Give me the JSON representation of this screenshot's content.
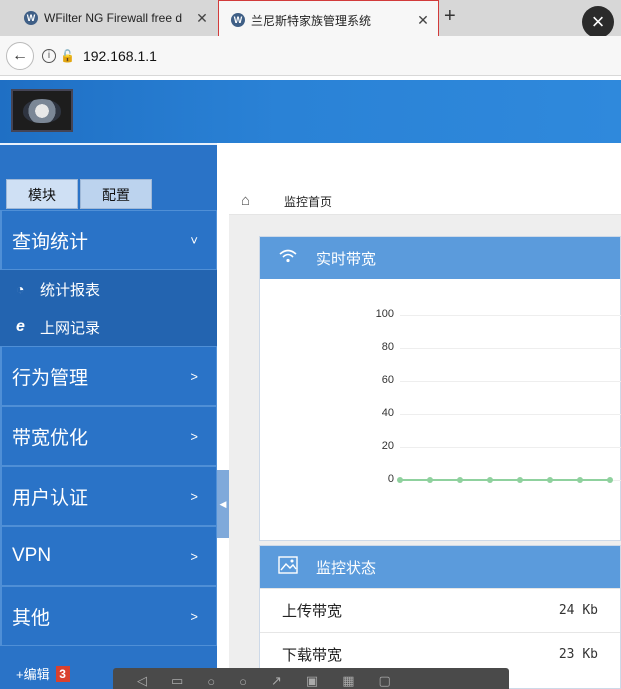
{
  "browser": {
    "tabs": [
      {
        "title": "WFilter NG Firewall free d",
        "active": false
      },
      {
        "title": "兰尼斯特家族管理系统",
        "active": true
      }
    ],
    "new_tab_label": "+",
    "close_label": "×",
    "address": "192.168.1.1",
    "back_label": "←"
  },
  "sidebar": {
    "tabs": [
      {
        "label": "模块"
      },
      {
        "label": "配置"
      }
    ],
    "menu": [
      {
        "label": "查询统计",
        "chevron": "˅",
        "expanded": true,
        "children": [
          {
            "label": "统计报表",
            "icon": "pie-chart-icon",
            "glyph": "◔"
          },
          {
            "label": "上网记录",
            "icon": "ie-icon",
            "glyph": "e"
          }
        ]
      },
      {
        "label": "行为管理",
        "chevron": ">"
      },
      {
        "label": "带宽优化",
        "chevron": ">"
      },
      {
        "label": "用户认证",
        "chevron": ">"
      },
      {
        "label": "VPN",
        "chevron": ">"
      },
      {
        "label": "其他",
        "chevron": ">"
      }
    ],
    "edit_label": "+编辑",
    "edit_badge": "3"
  },
  "breadcrumb": {
    "home_icon": "home-icon",
    "label": "监控首页"
  },
  "panels": {
    "bandwidth": {
      "title": "实时带宽",
      "icon": "wifi-icon"
    },
    "status": {
      "title": "监控状态",
      "icon": "image-icon",
      "rows": [
        {
          "label": "上传带宽",
          "value": "24 Kb"
        },
        {
          "label": "下载带宽",
          "value": "23 Kb"
        }
      ]
    }
  },
  "chart_data": {
    "type": "line",
    "y_ticks": [
      "100",
      "80",
      "60",
      "40",
      "20",
      "0"
    ],
    "ylim": [
      0,
      100
    ],
    "grid": true,
    "series": [
      {
        "color": "#8fd19e",
        "values": [
          0,
          0,
          0,
          0,
          0,
          0,
          0,
          0
        ]
      }
    ]
  },
  "colors": {
    "accent": "#2a73c7",
    "panel_head": "#5b9bdc",
    "series": "#8fd19e",
    "badge": "#d9412e"
  }
}
